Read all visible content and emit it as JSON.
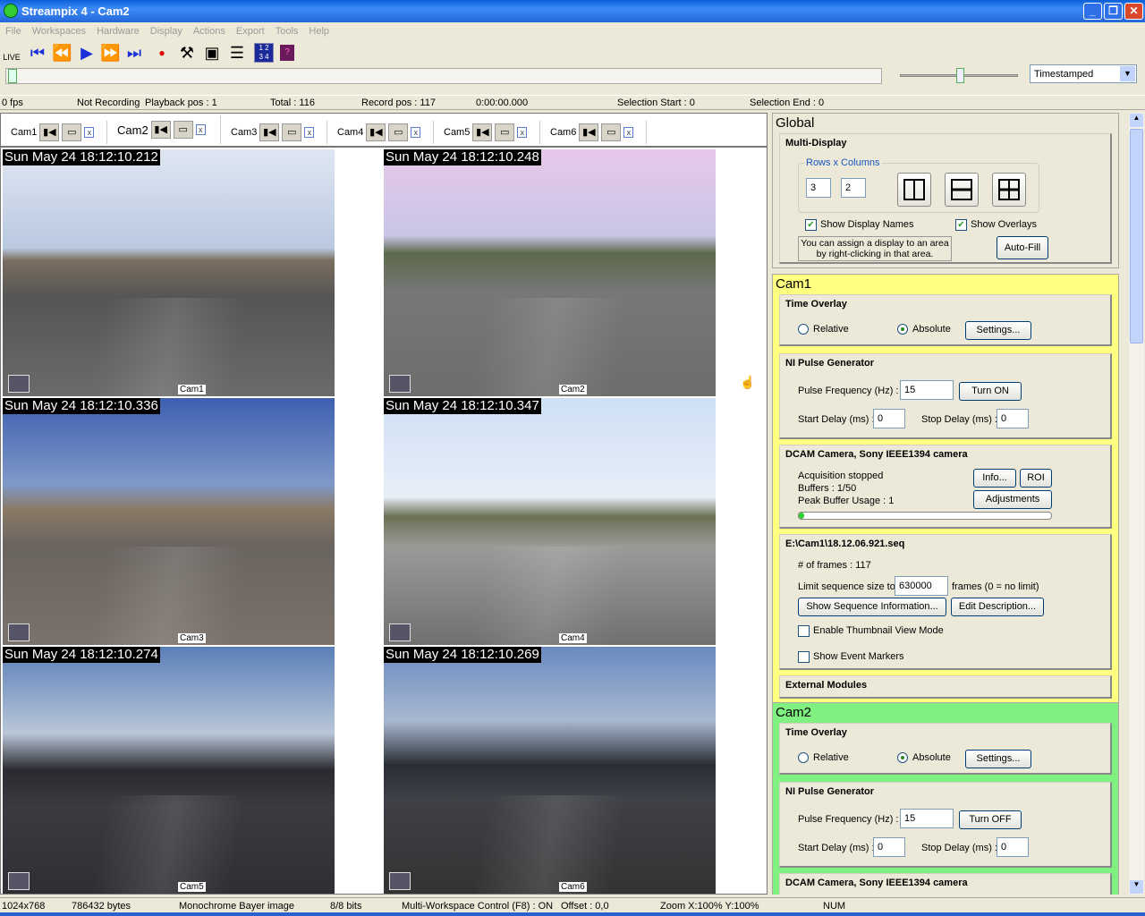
{
  "window": {
    "title": "Streampix 4 - Cam2"
  },
  "menu": [
    "File",
    "Workspaces",
    "Hardware",
    "Display",
    "Actions",
    "Export",
    "Tools",
    "Help"
  ],
  "toolbar": {
    "icons": [
      "live-camera-icon",
      "skip-first-icon",
      "rewind-icon",
      "play-icon",
      "fast-forward-icon",
      "skip-last-icon",
      "record-icon",
      "tools-icon",
      "camera-settings-icon",
      "adjust-icon",
      "multi-display-icon",
      "help-book-icon"
    ],
    "live_label": "LIVE",
    "display_mode": "Timestamped"
  },
  "playback_position": 0.0,
  "status": {
    "fps": "0 fps",
    "recording": "Not Recording",
    "playback": "Playback pos : 1",
    "total": "Total : 116",
    "record": "Record pos : 117",
    "time": "0:00:00.000",
    "sel_start": "Selection Start : 0",
    "sel_end": "Selection End : 0"
  },
  "tabs": [
    {
      "label": "Cam1"
    },
    {
      "label": "Cam2",
      "active": true
    },
    {
      "label": "Cam3"
    },
    {
      "label": "Cam4"
    },
    {
      "label": "Cam5"
    },
    {
      "label": "Cam6"
    }
  ],
  "tab_close": "x",
  "displays": [
    {
      "timestamp": "Sun May 24 18:12:10.212",
      "name": "Cam1"
    },
    {
      "timestamp": "Sun May 24 18:12:10.248",
      "name": "Cam2"
    },
    {
      "timestamp": "Sun May 24 18:12:10.336",
      "name": "Cam3"
    },
    {
      "timestamp": "Sun May 24 18:12:10.347",
      "name": "Cam4"
    },
    {
      "timestamp": "Sun May 24 18:12:10.274",
      "name": "Cam5"
    },
    {
      "timestamp": "Sun May 24 18:12:10.269",
      "name": "Cam6"
    }
  ],
  "global": {
    "title": "Global",
    "multi_display": "Multi-Display",
    "rows_cols_label": "Rows x Columns",
    "rows": "3",
    "cols": "2",
    "show_names": "Show Display Names",
    "show_overlays": "Show Overlays",
    "hint": "You can assign a display to an area by right-clicking in that area.",
    "autofill": "Auto-Fill"
  },
  "cam1": {
    "title": "Cam1",
    "color": "#ffff80",
    "time_overlay": "Time Overlay",
    "relative": "Relative",
    "absolute": "Absolute",
    "settings": "Settings...",
    "ni": "NI Pulse Generator",
    "freq_label": "Pulse Frequency (Hz) :",
    "freq": "15",
    "turn": "Turn ON",
    "start_label": "Start Delay (ms) :",
    "start": "0",
    "stop_label": "Stop Delay (ms) :",
    "stop": "0",
    "dcam": "DCAM Camera, Sony IEEE1394 camera",
    "acq": "Acquisition stopped",
    "buffers": "Buffers : 1/50",
    "peak": "Peak Buffer Usage : 1",
    "info": "Info...",
    "roi": "ROI",
    "adjust": "Adjustments",
    "buffer_fill": 0.02,
    "seq": "E:\\Cam1\\18.12.06.921.seq",
    "frames": "# of frames : 117",
    "limit_label": "Limit sequence size to",
    "limit": "630000",
    "limit_suffix": "frames (0 = no limit)",
    "show_seq": "Show Sequence Information...",
    "edit_desc": "Edit Description...",
    "thumb": "Enable Thumbnail View Mode",
    "markers": "Show Event Markers",
    "ext": "External Modules"
  },
  "cam2": {
    "title": "Cam2",
    "color": "#80f080",
    "time_overlay": "Time Overlay",
    "relative": "Relative",
    "absolute": "Absolute",
    "settings": "Settings...",
    "ni": "NI Pulse Generator",
    "freq_label": "Pulse Frequency (Hz) :",
    "freq": "15",
    "turn": "Turn OFF",
    "start_label": "Start Delay (ms) :",
    "start": "0",
    "stop_label": "Stop Delay (ms) :",
    "stop": "0",
    "dcam": "DCAM Camera, Sony IEEE1394 camera"
  },
  "bottom": {
    "res": "1024x768",
    "bytes": "786432 bytes",
    "format": "Monochrome Bayer image",
    "bits": "8/8 bits",
    "mwc": "Multi-Workspace Control (F8) : ON",
    "offset": "Offset : 0,0",
    "zoom": "Zoom X:100%  Y:100%",
    "num": "NUM"
  }
}
